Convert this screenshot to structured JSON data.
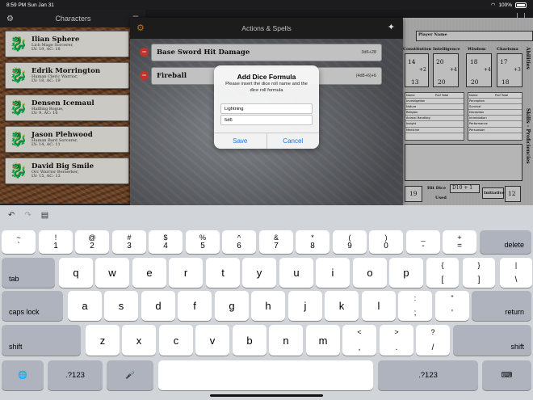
{
  "status": {
    "time": "8:59 PM",
    "date": "Sun Jan 31",
    "battery": "100%"
  },
  "characters_panel": {
    "title": "Characters",
    "items": [
      {
        "name": "Ilian Sphere",
        "line1": "Lich Mage Sorcerer,",
        "line2": "LV: 19, AC: 18"
      },
      {
        "name": "Edrik Morrington",
        "line1": "Human Cleric Warrior,",
        "line2": "LV: 18, AC: 19"
      },
      {
        "name": "Densen Icemaul",
        "line1": "Halfling Rogue,",
        "line2": "LV: 9, AC: 16"
      },
      {
        "name": "Jason Plehwood",
        "line1": "Human Bard Sorcerer,",
        "line2": "LV: 14, AC: 11"
      },
      {
        "name": "David Big Smile",
        "line1": "Orc Warrior Berserker,",
        "line2": "LV: 15, AC: 13"
      }
    ]
  },
  "sheet": {
    "player_name_label": "Player Name",
    "constitution": "Constitution",
    "intelligence": "Intelligence",
    "wisdom": "Wisdom",
    "charisma": "Charisma",
    "abilities_label": "Abilities",
    "skills_label": "Skills - Proficiencies",
    "stat_values": [
      "14",
      "20",
      "18",
      "17",
      "+2",
      "+4",
      "+4",
      "+3",
      "13",
      "20",
      "20",
      "18"
    ],
    "skill_col_header_name": "Name",
    "skill_col_header_prof": "Prof",
    "skill_col_header_total": "Total",
    "skills_left": [
      "Investigation",
      "Nature",
      "Religion",
      "Animal Handling",
      "Insight",
      "Medicine"
    ],
    "skills_right": [
      "Perception",
      "Survival",
      "Deception",
      "Intimidation",
      "Performance",
      "Persuasion"
    ],
    "hp_value": "19",
    "hit_dice_label": "Hit Dice",
    "hit_dice_value": "D10 + 1",
    "used_label": "Used",
    "initiative_label": "Initiative",
    "initiative_value": "12"
  },
  "actions_modal": {
    "title": "Actions & Spells",
    "actions": [
      {
        "name": "Base Sword Hit Damage",
        "formula": "3d6+28"
      },
      {
        "name": "Fireball",
        "formula": "(4d8+6)+6"
      }
    ]
  },
  "alert": {
    "title": "Add Dice Formula",
    "message": "Please insert the dice roll name and the dice roll formula",
    "name_value": "Lightning",
    "formula_value": "5d6",
    "save_label": "Save",
    "cancel_label": "Cancel"
  },
  "keyboard": {
    "row1": [
      {
        "top": "~",
        "bottom": "`"
      },
      {
        "top": "!",
        "bottom": "1"
      },
      {
        "top": "@",
        "bottom": "2"
      },
      {
        "top": "#",
        "bottom": "3"
      },
      {
        "top": "$",
        "bottom": "4"
      },
      {
        "top": "%",
        "bottom": "5"
      },
      {
        "top": "^",
        "bottom": "6"
      },
      {
        "top": "&",
        "bottom": "7"
      },
      {
        "top": "*",
        "bottom": "8"
      },
      {
        "top": "(",
        "bottom": "9"
      },
      {
        "top": ")",
        "bottom": "0"
      },
      {
        "top": "_",
        "bottom": "-"
      },
      {
        "top": "+",
        "bottom": "="
      }
    ],
    "delete_label": "delete",
    "tab_label": "tab",
    "row2": [
      "q",
      "w",
      "e",
      "r",
      "t",
      "y",
      "u",
      "i",
      "o",
      "p"
    ],
    "row2_extra": [
      {
        "top": "{",
        "bottom": "["
      },
      {
        "top": "}",
        "bottom": "]"
      },
      {
        "top": "|",
        "bottom": "\\"
      }
    ],
    "caps_label": "caps lock",
    "row3": [
      "a",
      "s",
      "d",
      "f",
      "g",
      "h",
      "j",
      "k",
      "l"
    ],
    "row3_extra": [
      {
        "top": ":",
        "bottom": ";"
      },
      {
        "top": "\"",
        "bottom": "'"
      }
    ],
    "return_label": "return",
    "shift_label": "shift",
    "row4": [
      "z",
      "x",
      "c",
      "v",
      "b",
      "n",
      "m"
    ],
    "row4_extra": [
      {
        "top": "<",
        "bottom": ","
      },
      {
        "top": ">",
        "bottom": "."
      },
      {
        "top": "?",
        "bottom": "/"
      }
    ],
    "numbers_label": ".?123"
  },
  "colors": {
    "accent_orange": "#e07a20",
    "minus_red": "#e03a2f",
    "ios_blue": "#1a73e8"
  }
}
